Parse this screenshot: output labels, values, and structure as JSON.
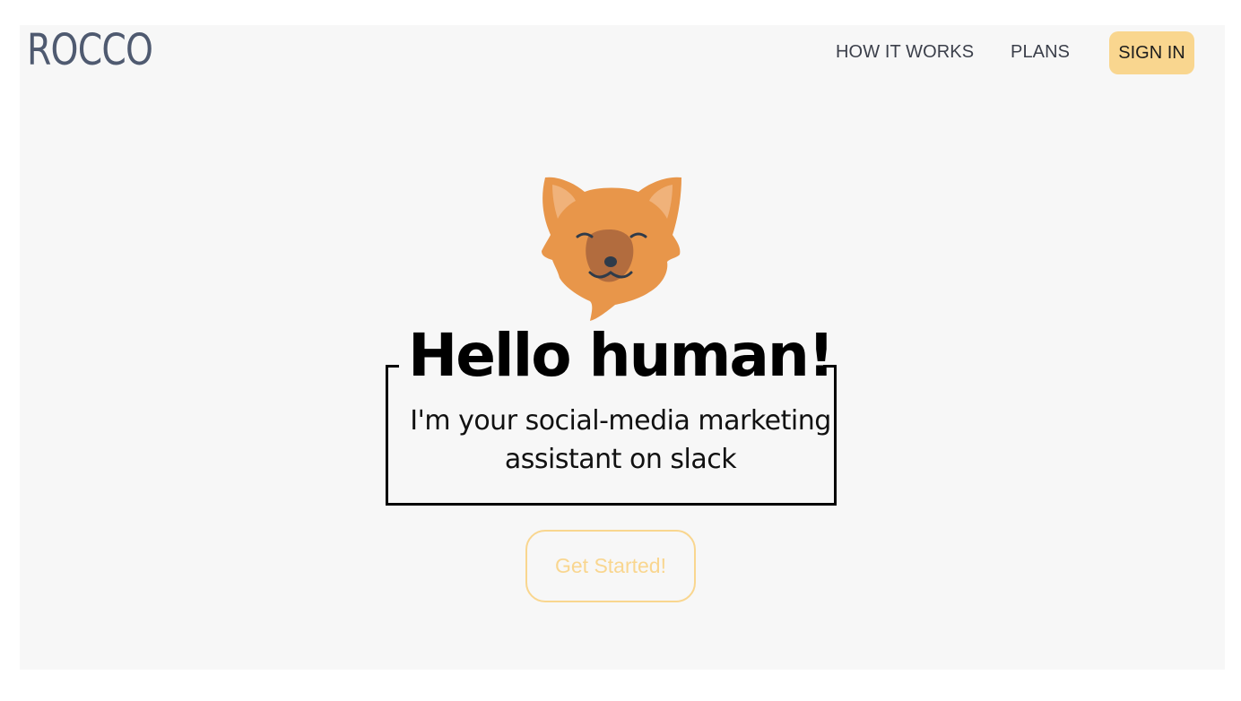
{
  "brand": {
    "logo": "ROCCO"
  },
  "nav": {
    "how_it_works": "HOW IT WORKS",
    "plans": "PLANS",
    "sign_in": "SIGN IN"
  },
  "hero": {
    "mascot_icon": "fox-head-icon",
    "headline": "Hello human!",
    "subline_1": "I'm your social-media marketing",
    "subline_2": "assistant on slack",
    "cta": "Get Started!"
  },
  "colors": {
    "accent": "#f9d68f",
    "logo": "#4f5a70",
    "fox": "#e8964a",
    "background": "#f7f7f7"
  }
}
